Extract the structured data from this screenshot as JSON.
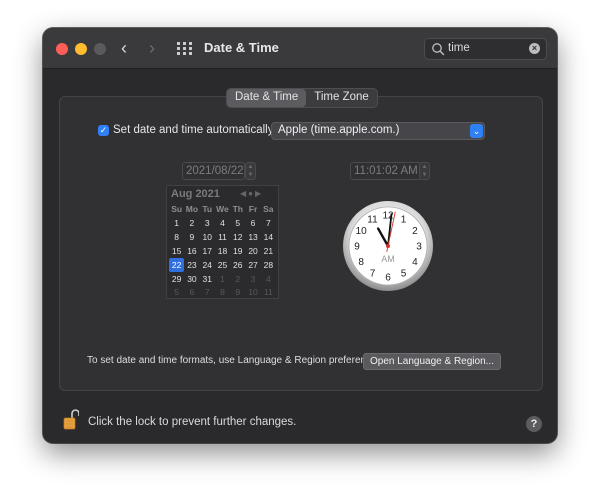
{
  "window": {
    "title": "Date & Time"
  },
  "search": {
    "value": "time"
  },
  "tabs": [
    {
      "label": "Date & Time",
      "selected": true
    },
    {
      "label": "Time Zone",
      "selected": false
    }
  ],
  "auto": {
    "checked": true,
    "label": "Set date and time automatically:",
    "server": "Apple (time.apple.com.)"
  },
  "date_field": "2021/08/22",
  "time_field": "11:01:02 AM",
  "calendar": {
    "month": "Aug 2021",
    "weekdays": [
      "Su",
      "Mo",
      "Tu",
      "We",
      "Th",
      "Fr",
      "Sa"
    ],
    "weeks": [
      [
        "1",
        "2",
        "3",
        "4",
        "5",
        "6",
        "7"
      ],
      [
        "8",
        "9",
        "10",
        "11",
        "12",
        "13",
        "14"
      ],
      [
        "15",
        "16",
        "17",
        "18",
        "19",
        "20",
        "21"
      ],
      [
        "22",
        "23",
        "24",
        "25",
        "26",
        "27",
        "28"
      ],
      [
        "29",
        "30",
        "31",
        "1",
        "2",
        "3",
        "4"
      ],
      [
        "5",
        "6",
        "7",
        "8",
        "9",
        "10",
        "11"
      ]
    ],
    "selected_day": "22"
  },
  "clock": {
    "numbers": [
      "12",
      "1",
      "2",
      "3",
      "4",
      "5",
      "6",
      "7",
      "8",
      "9",
      "10",
      "11"
    ],
    "period": "AM",
    "time": {
      "hour": 11,
      "minute": 1,
      "second": 2
    }
  },
  "footer": {
    "formats_text": "To set date and time formats, use Language & Region preferences.",
    "lang_button": "Open Language & Region...",
    "lock_text": "Click the lock to prevent further changes.",
    "help": "?"
  },
  "colors": {
    "accent": "#2f7ff5",
    "window_bg": "#2a2a2c",
    "second_hand": "#d0342c"
  },
  "icons": [
    "chevron-left-icon",
    "chevron-right-icon",
    "grid-icon",
    "search-icon",
    "clear-icon",
    "lock-icon",
    "help-icon"
  ]
}
